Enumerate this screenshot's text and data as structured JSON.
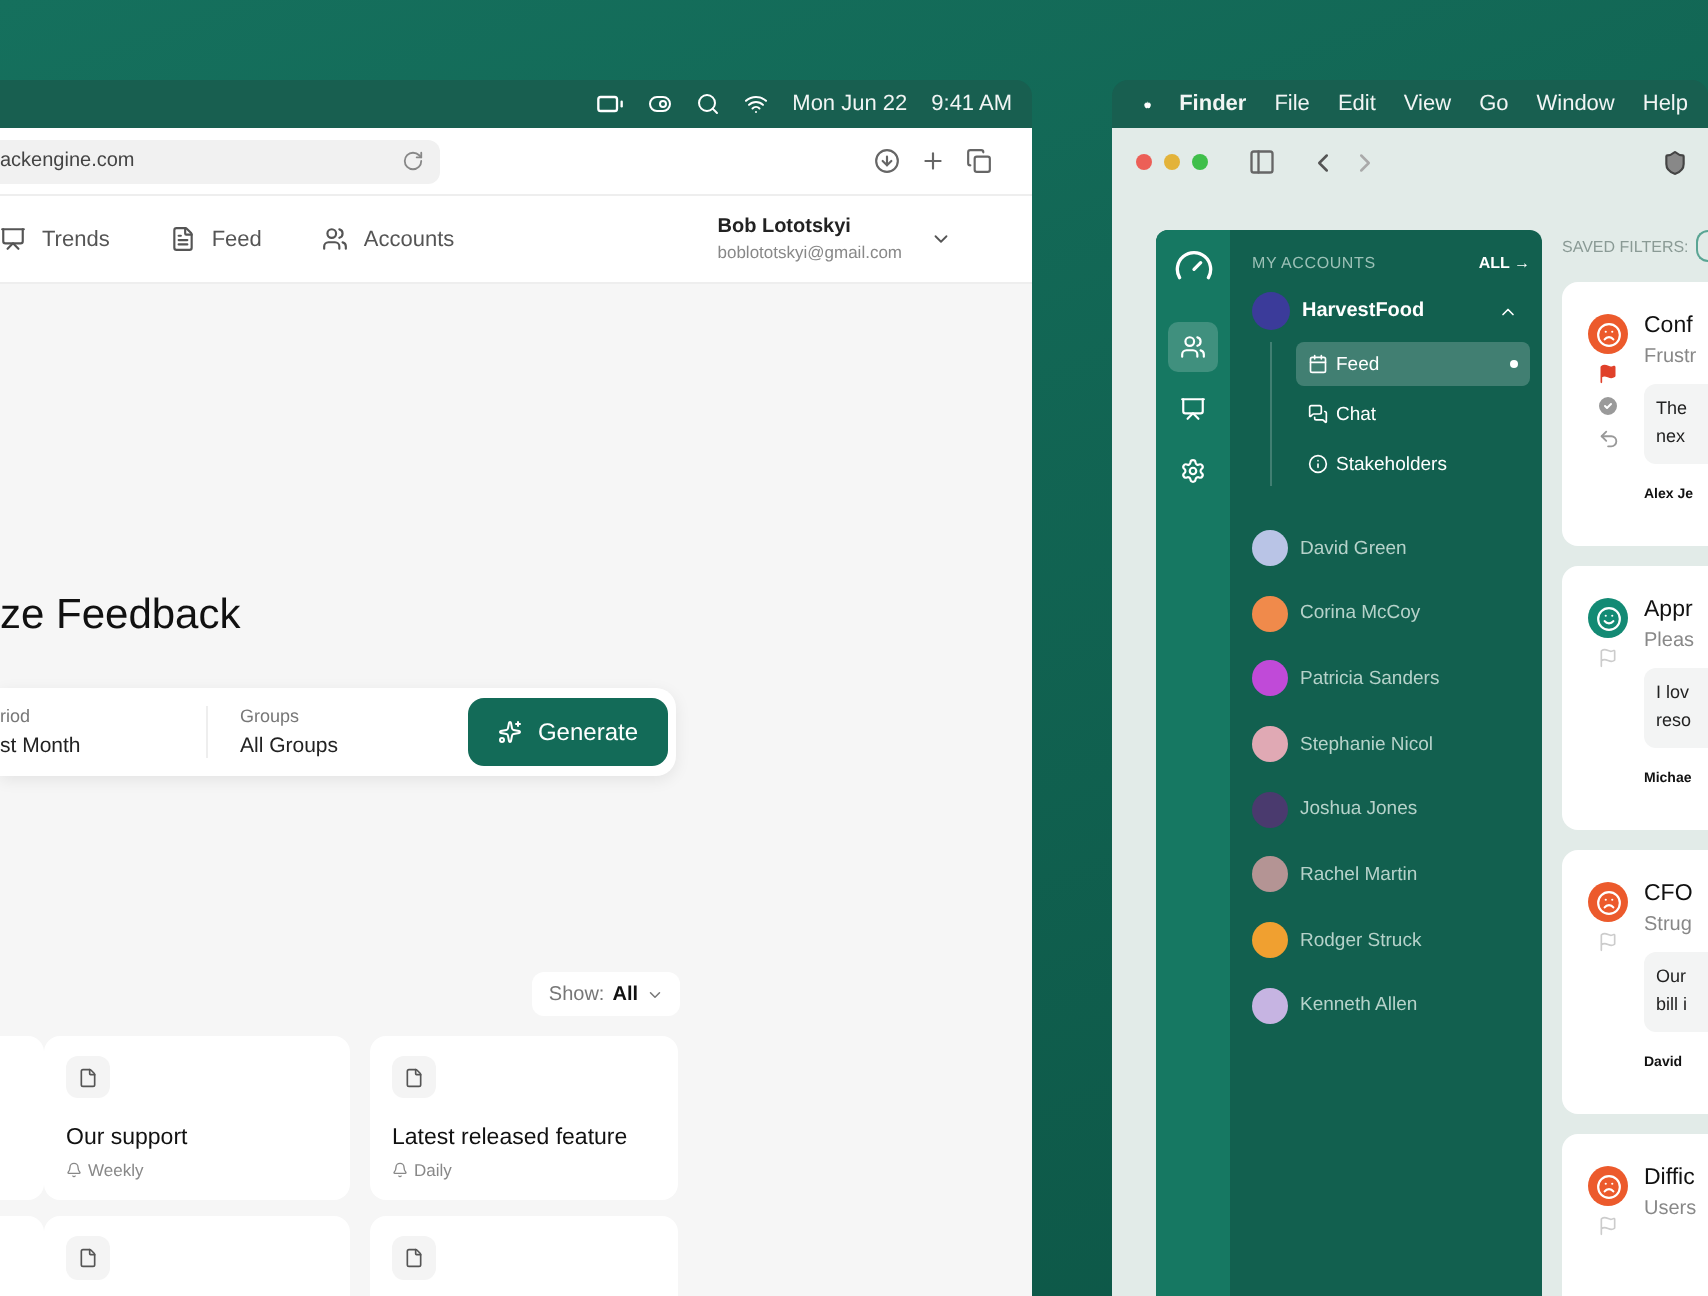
{
  "browser_screen": {
    "menubar": {
      "date": "Mon Jun 22",
      "time": "9:41 AM"
    },
    "toolbar": {
      "url": "ackengine.com"
    },
    "nav": {
      "tabs": [
        {
          "label": "Trends",
          "selected": false
        },
        {
          "label": "Feed",
          "selected": false
        },
        {
          "label": "Accounts",
          "selected": false
        }
      ],
      "user": {
        "name": "Bob Lototskyi",
        "email": "boblototskyi@gmail.com"
      }
    },
    "page": {
      "title": "ze Feedback",
      "filters": [
        {
          "label": "riod",
          "value": "st Month"
        },
        {
          "label": "Groups",
          "value": "All Groups"
        }
      ],
      "generate_button": "Generate",
      "show_filter": {
        "label": "Show:",
        "value": "All"
      },
      "cards": [
        {
          "kind": "edge"
        },
        {
          "kind": "full",
          "title": "Our support",
          "schedule": "Weekly"
        },
        {
          "kind": "full",
          "title": "Latest released feature",
          "schedule": "Daily"
        },
        {
          "kind": "edge"
        },
        {
          "kind": "icon_only"
        },
        {
          "kind": "icon_only"
        }
      ]
    }
  },
  "finder_screen": {
    "menubar": {
      "items": [
        {
          "label": "Finder",
          "bold": true
        },
        {
          "label": "File",
          "bold": false
        },
        {
          "label": "Edit",
          "bold": false
        },
        {
          "label": "View",
          "bold": false
        },
        {
          "label": "Go",
          "bold": false
        },
        {
          "label": "Window",
          "bold": false
        },
        {
          "label": "Help",
          "bold": false
        }
      ]
    },
    "sidebar": {
      "rail": [
        {
          "selected": true
        },
        {
          "selected": false
        },
        {
          "selected": false
        }
      ],
      "header": "MY ACCOUNTS",
      "all_link": "ALL →",
      "account": {
        "name": "HarvestFood",
        "expanded": true,
        "children": [
          {
            "label": "Feed",
            "selected": true
          },
          {
            "label": "Chat",
            "selected": false
          },
          {
            "label": "Stakeholders",
            "selected": false
          }
        ]
      },
      "people": [
        {
          "name": "David Green",
          "color": "#b9c4e6"
        },
        {
          "name": "Corina McCoy",
          "color": "#f08a4b"
        },
        {
          "name": "Patricia Sanders",
          "color": "#c04ad8"
        },
        {
          "name": "Stephanie Nicol",
          "color": "#e0a9b4"
        },
        {
          "name": "Joshua Jones",
          "color": "#4a3a6e"
        },
        {
          "name": "Rachel Martin",
          "color": "#b49494"
        },
        {
          "name": "Rodger Struck",
          "color": "#f0a030"
        },
        {
          "name": "Kenneth Allen",
          "color": "#c6b4e2"
        }
      ]
    },
    "feed": {
      "saved_filters_label": "SAVED FILTERS:",
      "cards": [
        {
          "kind": "negative",
          "flagged": true,
          "actions": true,
          "title": "Conf",
          "subtitle": "Frustr",
          "quote": [
            "The",
            "nex"
          ],
          "author": "Alex Je"
        },
        {
          "kind": "positive",
          "flagged": false,
          "actions": false,
          "title": "Appr",
          "subtitle": "Pleas",
          "quote": [
            "I lov",
            "reso"
          ],
          "author": "Michae"
        },
        {
          "kind": "negative",
          "flagged": false,
          "actions": false,
          "title": "CFO",
          "subtitle": "Strug",
          "quote": [
            "Our",
            "bill i"
          ],
          "author": "David"
        },
        {
          "kind": "negative",
          "flagged": false,
          "actions": false,
          "title": "Diffic",
          "subtitle": "Users"
        }
      ]
    }
  }
}
